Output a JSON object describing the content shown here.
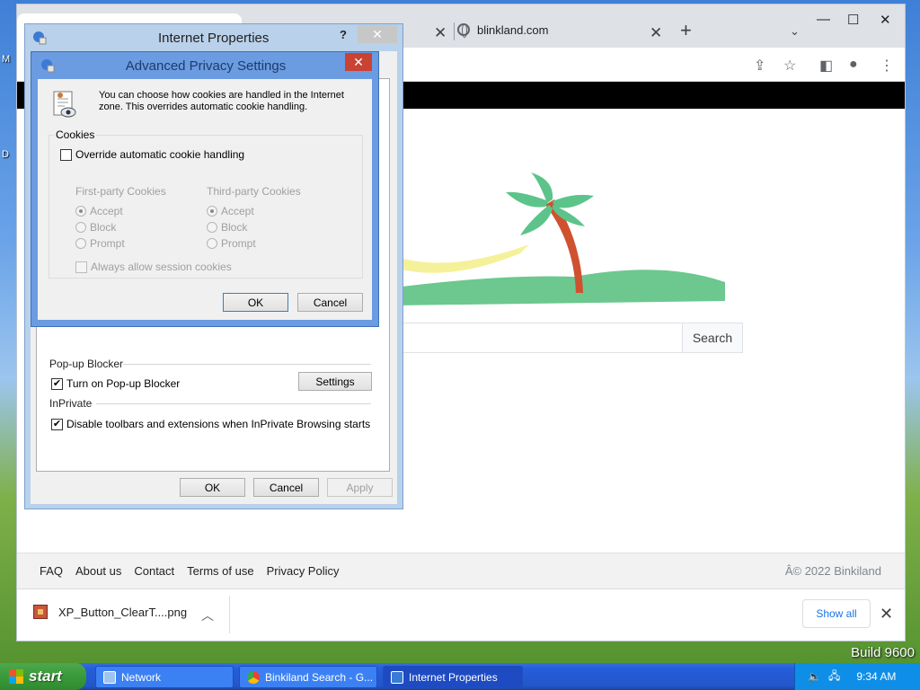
{
  "desktop": {
    "edge_letters": [
      "M",
      "D"
    ],
    "build_text": "Build 9600"
  },
  "browser": {
    "tabs": [
      {
        "label": "",
        "active": true
      },
      {
        "label": "blinkland.com",
        "active": false
      }
    ],
    "search_button": "Search",
    "footer_links": [
      "FAQ",
      "About us",
      "Contact",
      "Terms of use",
      "Privacy Policy"
    ],
    "copyright": "Â© 2022 Binkiland",
    "download": {
      "filename": "XP_Button_ClearT....png",
      "show_all": "Show all"
    }
  },
  "internet_properties": {
    "title": "Internet Properties",
    "help_glyph": "?",
    "popup_group": "Pop-up Blocker",
    "popup_checkbox": "Turn on Pop-up Blocker",
    "popup_checked": true,
    "settings_button": "Settings",
    "inprivate_group": "InPrivate",
    "inprivate_checkbox": "Disable toolbars and extensions when InPrivate Browsing starts",
    "inprivate_checked": true,
    "ok": "OK",
    "cancel": "Cancel",
    "apply": "Apply"
  },
  "advanced_privacy": {
    "title": "Advanced Privacy Settings",
    "description": "You can choose how cookies are handled in the Internet zone.  This overrides automatic cookie handling.",
    "cookies_group": "Cookies",
    "override_checkbox": "Override automatic cookie handling",
    "override_checked": false,
    "first_party": {
      "heading": "First-party Cookies",
      "options": [
        "Accept",
        "Block",
        "Prompt"
      ],
      "selected": "Accept"
    },
    "third_party": {
      "heading": "Third-party Cookies",
      "options": [
        "Accept",
        "Block",
        "Prompt"
      ],
      "selected": "Accept"
    },
    "session_checkbox": "Always allow session cookies",
    "ok": "OK",
    "cancel": "Cancel"
  },
  "taskbar": {
    "start": "start",
    "tasks": [
      "Network",
      "Binkiland Search - G...",
      "Internet Properties"
    ],
    "active_task": "Internet Properties",
    "clock": "9:34 AM"
  },
  "colors": {
    "palm_leaf": "#5cc48a",
    "palm_trunk": "#cf5130",
    "hill": "#6cc88e",
    "sun_streak": "#f5f19a"
  }
}
